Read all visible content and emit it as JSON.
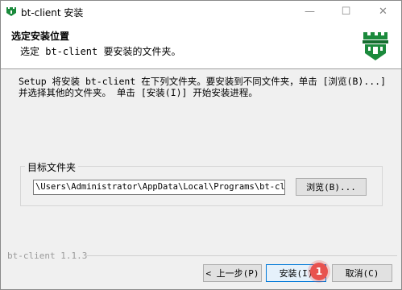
{
  "window": {
    "title": "bt-client 安装",
    "controls": {
      "minimize": "—",
      "maximize": "☐",
      "close": "✕"
    }
  },
  "header": {
    "title": "选定安装位置",
    "subtitle": "选定 bt-client 要安装的文件夹。",
    "logo_icon": "castle-tower-icon",
    "logo_color": "#1b8a3c"
  },
  "body": {
    "description": "Setup 将安装 bt-client 在下列文件夹。要安装到不同文件夹，单击 [浏览(B)...] 并选择其他的文件夹。 单击 [安装(I)] 开始安装进程。",
    "dest_group_label": "目标文件夹",
    "dest_path": "\\Users\\Administrator\\AppData\\Local\\Programs\\bt-client",
    "browse_label": "浏览(B)..."
  },
  "footer": {
    "brand": "bt-client 1.1.3",
    "back_label": "< 上一步(P)",
    "install_label": "安装(I)",
    "cancel_label": "取消(C)",
    "badge": "1",
    "badge_color": "#e8524f"
  }
}
